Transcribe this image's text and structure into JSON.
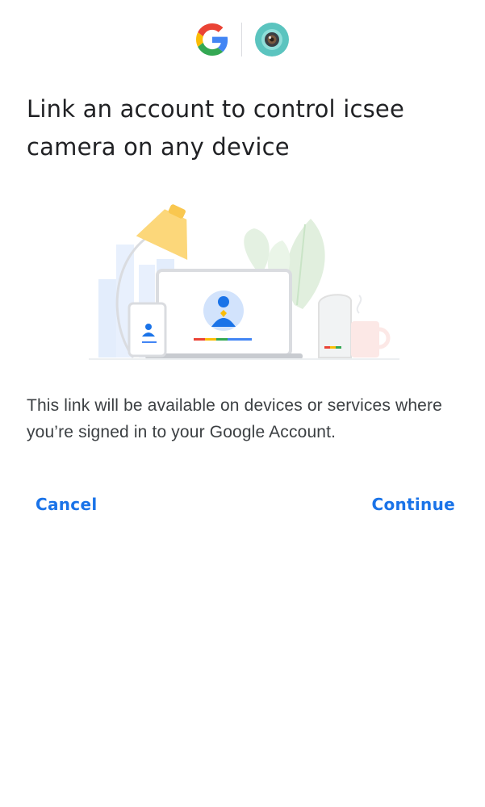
{
  "header": {
    "google_logo_icon": "google-g-icon",
    "app_logo_icon": "icsee-camera-icon"
  },
  "title": "Link an account to control icsee camera on any device",
  "illustration": {
    "icon": "linked-devices-illustration"
  },
  "description": "This link will be available on devices or services where you’re signed in to your Google Account.",
  "actions": {
    "cancel_label": "Cancel",
    "continue_label": "Continue"
  },
  "colors": {
    "accent": "#1a73e8",
    "google_blue": "#4285f4",
    "google_red": "#ea4335",
    "google_yellow": "#fbbc05",
    "google_green": "#34a853",
    "app_teal": "#5bc4bf"
  }
}
